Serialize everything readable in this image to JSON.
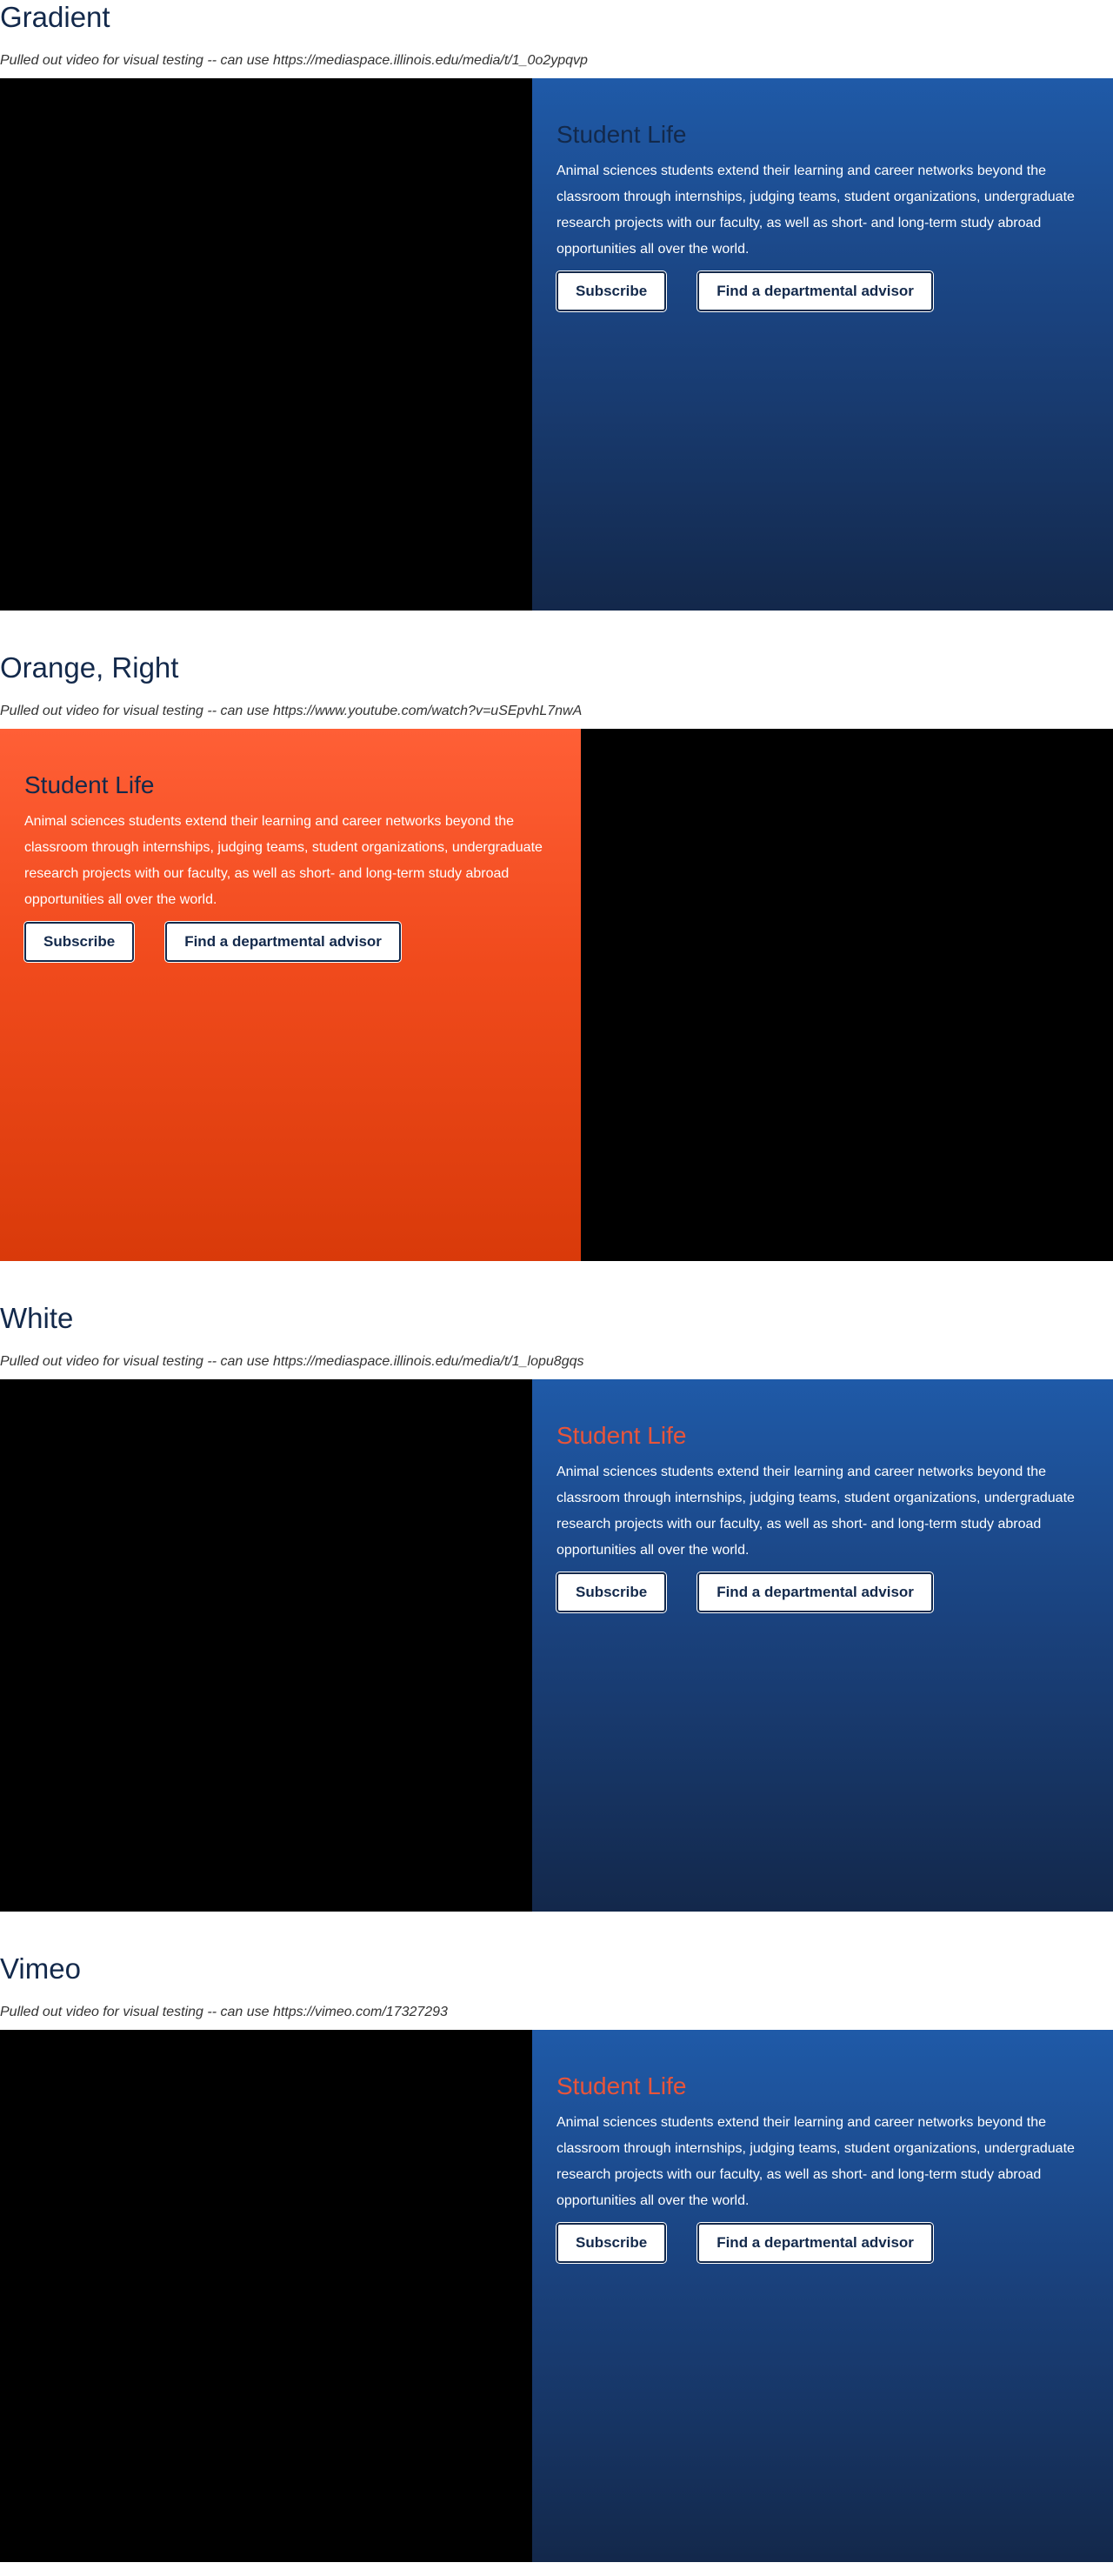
{
  "sections": [
    {
      "heading": "Gradient",
      "note": "Pulled out video for visual testing -- can use https://mediaspace.illinois.edu/media/t/1_0o2ypqvp",
      "title": "Student Life",
      "text": "Animal sciences students extend their learning and career networks beyond the classroom through internships, judging teams, student organizations, undergraduate research projects with our faculty, as well as short- and long-term study abroad opportunities all over the world.",
      "button1": "Subscribe",
      "button2": "Find a departmental advisor"
    },
    {
      "heading": "Orange, Right",
      "note": "Pulled out video for visual testing -- can use https://www.youtube.com/watch?v=uSEpvhL7nwA",
      "title": "Student Life",
      "text": "Animal sciences students extend their learning and career networks beyond the classroom through internships, judging teams, student organizations, undergraduate research projects with our faculty, as well as short- and long-term study abroad opportunities all over the world.",
      "button1": "Subscribe",
      "button2": "Find a departmental advisor"
    },
    {
      "heading": "White",
      "note": "Pulled out video for visual testing -- can use https://mediaspace.illinois.edu/media/t/1_lopu8gqs",
      "title": "Student Life",
      "text": "Animal sciences students extend their learning and career networks beyond the classroom through internships, judging teams, student organizations, undergraduate research projects with our faculty, as well as short- and long-term study abroad opportunities all over the world.",
      "button1": "Subscribe",
      "button2": "Find a departmental advisor"
    },
    {
      "heading": "Vimeo",
      "note": "Pulled out video for visual testing -- can use https://vimeo.com/17327293",
      "title": "Student Life",
      "text": "Animal sciences students extend their learning and career networks beyond the classroom through internships, judging teams, student organizations, undergraduate research projects with our faculty, as well as short- and long-term study abroad opportunities all over the world.",
      "button1": "Subscribe",
      "button2": "Find a departmental advisor"
    }
  ],
  "colors": {
    "navy": "#13294b",
    "blue_gradient_top": "#1f5aa8",
    "orange_gradient_top": "#ff5f36",
    "accent_orange": "#e8553a",
    "video_black": "#000000"
  }
}
